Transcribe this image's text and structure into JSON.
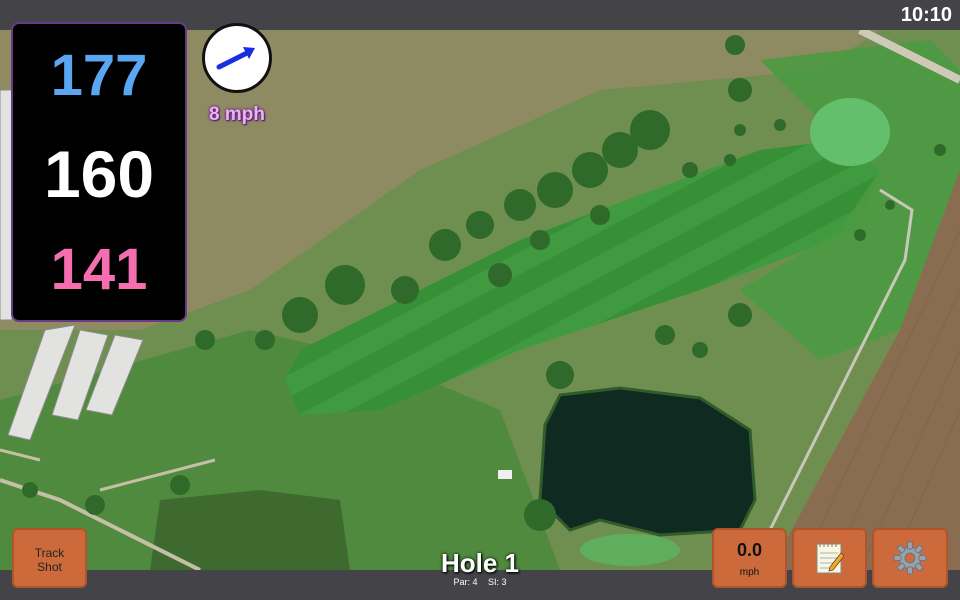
{
  "status_bar": {
    "time": "10:10"
  },
  "distances": {
    "back": "177",
    "middle": "160",
    "front": "141"
  },
  "wind": {
    "speed": "8 mph",
    "icon": "wind-direction-arrow-icon"
  },
  "hole": {
    "title": "Hole 1",
    "par": "Par: 4",
    "si": "SI: 3"
  },
  "buttons": {
    "track_shot_line1": "Track",
    "track_shot_line2": "Shot",
    "speed_value": "0.0",
    "speed_unit": "mph",
    "notes_icon": "notepad-icon",
    "settings_icon": "gear-icon"
  },
  "colors": {
    "back": "#5aa6f0",
    "middle": "#ffffff",
    "front": "#f56fb0",
    "button": "#cc6a3c",
    "wind_text": "#e9b4f2"
  }
}
